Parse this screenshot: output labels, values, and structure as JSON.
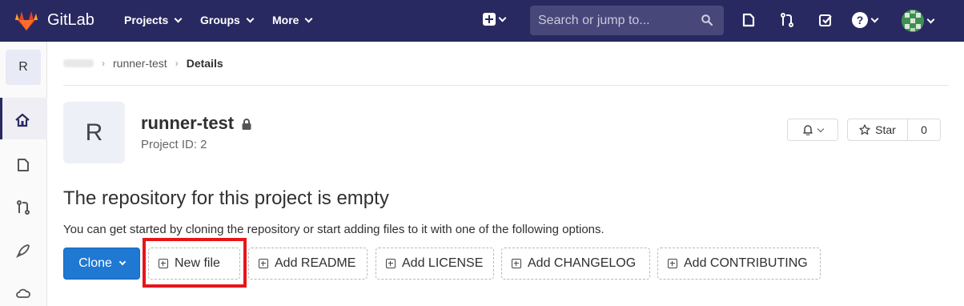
{
  "topnav": {
    "brand": "GitLab",
    "items": [
      {
        "label": "Projects"
      },
      {
        "label": "Groups"
      },
      {
        "label": "More"
      }
    ],
    "search_placeholder": "Search or jump to...",
    "help_glyph": "?",
    "icons": [
      "gitlab-logo",
      "plus-square-icon",
      "search-icon",
      "issues-icon",
      "merge-request-icon",
      "todo-check-icon",
      "help-icon",
      "user-avatar"
    ]
  },
  "sidebar": {
    "project_letter": "R",
    "icons": [
      "home-icon",
      "issues-icon",
      "merge-request-icon",
      "rocket-icon",
      "cloud-icon"
    ]
  },
  "breadcrumb": {
    "parent": "runner-test",
    "current": "Details"
  },
  "project": {
    "avatar_letter": "R",
    "name": "runner-test",
    "id_text": "Project ID: 2",
    "star_label": "Star",
    "star_count": "0"
  },
  "empty_state": {
    "title": "The repository for this project is empty",
    "description": "You can get started by cloning the repository or start adding files to it with one of the following options."
  },
  "actions": {
    "clone_label": "Clone",
    "buttons": [
      {
        "label": "New file"
      },
      {
        "label": "Add README"
      },
      {
        "label": "Add LICENSE"
      },
      {
        "label": "Add CHANGELOG"
      },
      {
        "label": "Add CONTRIBUTING"
      }
    ]
  },
  "colors": {
    "nav_bg": "#292961",
    "primary": "#1f78d1",
    "highlight": "#e8141b"
  }
}
